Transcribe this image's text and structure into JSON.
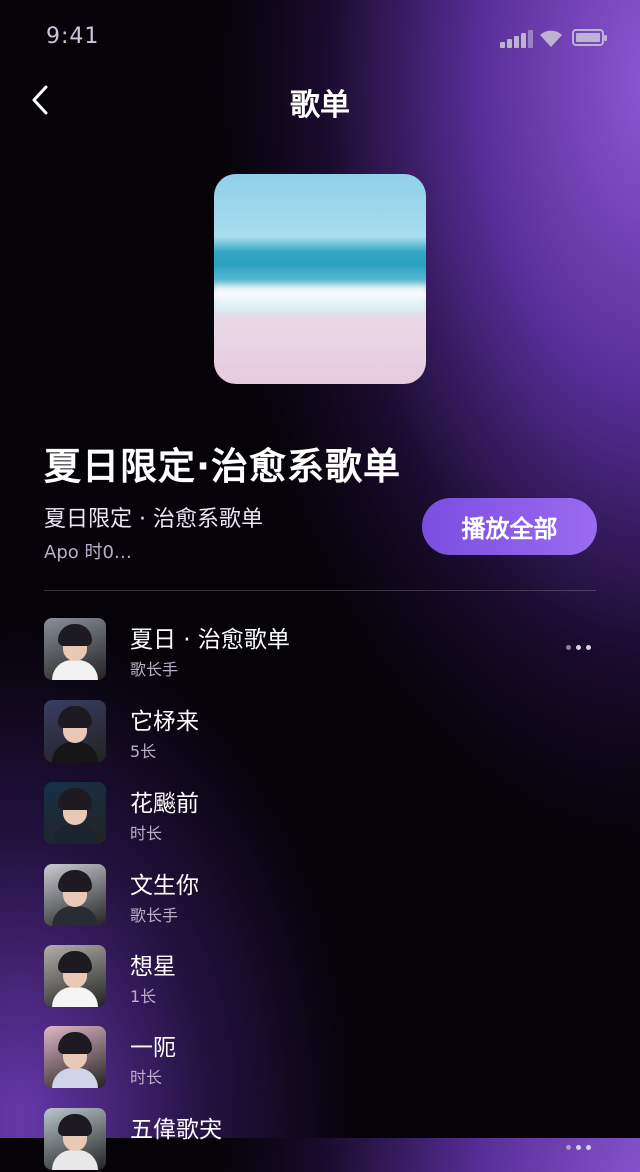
{
  "status_bar": {
    "time": "9:41"
  },
  "header": {
    "title": "歌单"
  },
  "playlist": {
    "title": "夏日限定·治愈系歌单",
    "subtitle": "夏日限定 · 治愈系歌单",
    "meta": "Apo 时0…",
    "play_all_label": "播放全部"
  },
  "songs": [
    {
      "name": "夏日 · 治愈歌单",
      "sub": "歌长手",
      "avatar_bg": "#8a8f99",
      "shirt": "#f2f2f2"
    },
    {
      "name": "它柕来",
      "sub": "5长",
      "avatar_bg": "#3a3d63",
      "shirt": "#151515"
    },
    {
      "name": "花飈前",
      "sub": "时长",
      "avatar_bg": "#163048",
      "shirt": "#1b2330"
    },
    {
      "name": "文生你",
      "sub": "歌长手",
      "avatar_bg": "#c9ccd2",
      "shirt": "#2a2c34"
    },
    {
      "name": "想星",
      "sub": "1长",
      "avatar_bg": "#b3b0ab",
      "shirt": "#f5f5f5"
    },
    {
      "name": "一阨",
      "sub": "时长",
      "avatar_bg": "#e0b6c6",
      "shirt": "#cfd4e8"
    },
    {
      "name": "五偉歌宊",
      "sub": "",
      "avatar_bg": "#b9c7cc",
      "shirt": "#e8e8e8"
    }
  ]
}
